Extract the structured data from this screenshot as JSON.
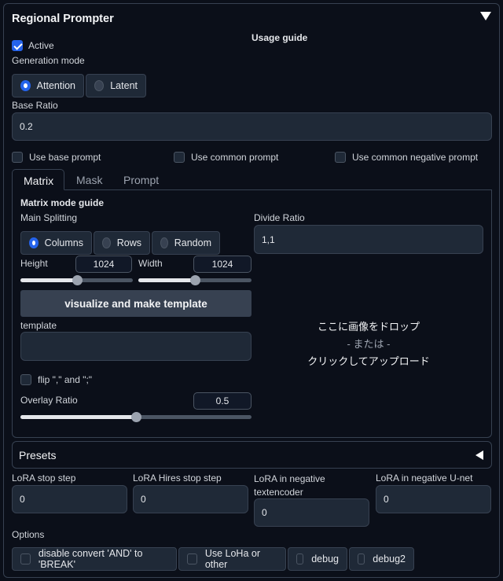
{
  "header": {
    "title": "Regional Prompter",
    "usage_guide": "Usage guide"
  },
  "active": {
    "label": "Active",
    "checked": true
  },
  "generation_mode": {
    "label": "Generation mode",
    "options": [
      "Attention",
      "Latent"
    ],
    "selected": "Attention"
  },
  "base_ratio": {
    "label": "Base Ratio",
    "value": "0.2"
  },
  "prompt_toggles": [
    "Use base prompt",
    "Use common prompt",
    "Use common negative prompt"
  ],
  "tabs": [
    "Matrix",
    "Mask",
    "Prompt"
  ],
  "active_tab": "Matrix",
  "matrix": {
    "guide": "Matrix mode guide",
    "main_splitting_label": "Main Splitting",
    "splitting_options": [
      "Columns",
      "Rows",
      "Random"
    ],
    "splitting_selected": "Columns",
    "divide_ratio_label": "Divide Ratio",
    "divide_ratio_value": "1,1",
    "height_label": "Height",
    "height_value": "1024",
    "height_level": 0.5,
    "width_label": "Width",
    "width_value": "1024",
    "width_level": 0.5,
    "visualize_button": "visualize and make template",
    "template_label": "template",
    "template_value": "",
    "flip_label": "flip \",\" and \";\"",
    "overlay_ratio_label": "Overlay Ratio",
    "overlay_ratio_value": "0.5",
    "overlay_level": 0.5,
    "drop_zone": {
      "line1": "ここに画像をドロップ",
      "line2": "- または -",
      "line3": "クリックしてアップロード"
    }
  },
  "presets": {
    "label": "Presets"
  },
  "lora": [
    {
      "label": "LoRA stop step",
      "value": "0"
    },
    {
      "label": "LoRA Hires stop step",
      "value": "0"
    },
    {
      "label": "LoRA in negative textencoder",
      "value": "0"
    },
    {
      "label": "LoRA in negative U-net",
      "value": "0"
    }
  ],
  "options": {
    "label": "Options",
    "items": [
      "disable convert 'AND' to 'BREAK'",
      "Use LoHa or other",
      "debug",
      "debug2"
    ]
  },
  "colors": {
    "accent": "#2563eb",
    "background": "#0b0f19",
    "surface": "#1f2937",
    "border": "#374151"
  }
}
